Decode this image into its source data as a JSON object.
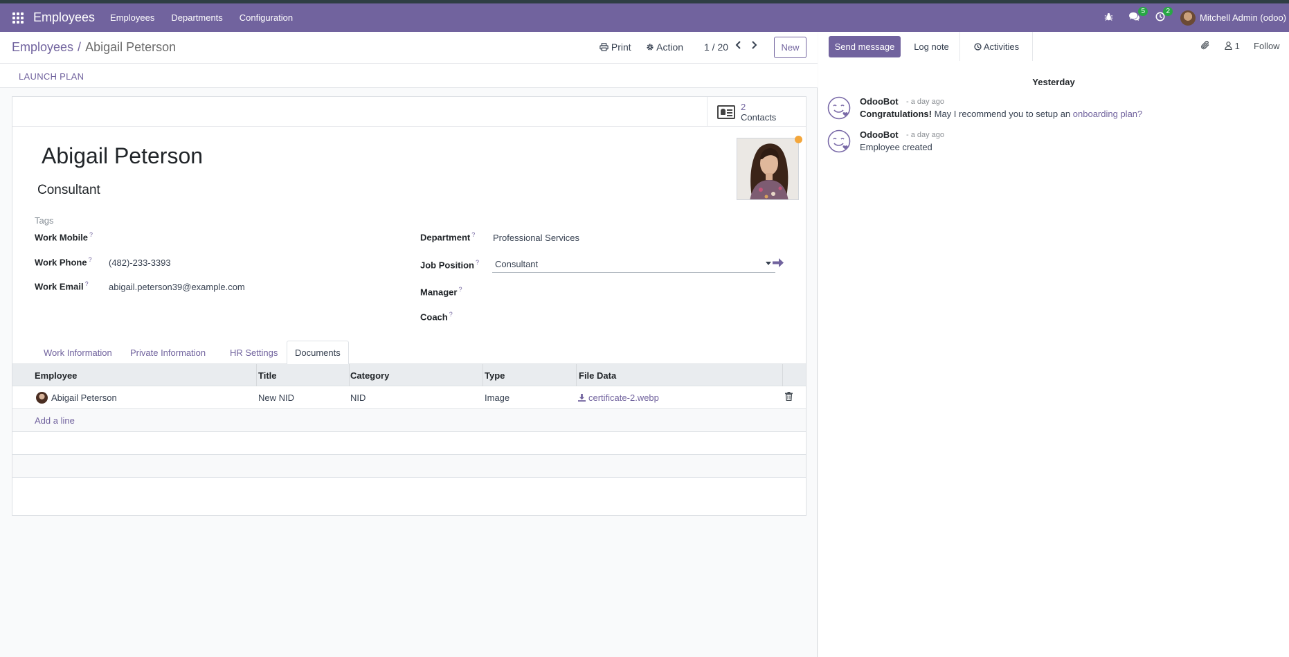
{
  "navbar": {
    "app_name": "Employees",
    "menu": [
      "Employees",
      "Departments",
      "Configuration"
    ],
    "messages_count": "5",
    "activities_count": "2",
    "user_name": "Mitchell Admin (odoo)"
  },
  "control_panel": {
    "breadcrumb_parent": "Employees",
    "breadcrumb_current": "Abigail Peterson",
    "print_label": "Print",
    "action_label": "Action",
    "pager": "1 / 20",
    "new_label": "New"
  },
  "statusbar": {
    "launch_plan": "LAUNCH PLAN"
  },
  "stat_buttons": {
    "contacts_value": "2",
    "contacts_label": "Contacts"
  },
  "employee": {
    "name": "Abigail Peterson",
    "job_title": "Consultant",
    "tags_placeholder": "Tags",
    "status_color": "#f3a63b"
  },
  "fields": {
    "work_mobile_label": "Work Mobile",
    "work_mobile_value": "",
    "work_phone_label": "Work Phone",
    "work_phone_value": "(482)-233-3393",
    "work_email_label": "Work Email",
    "work_email_value": "abigail.peterson39@example.com",
    "department_label": "Department",
    "department_value": "Professional Services",
    "job_position_label": "Job Position",
    "job_position_value": "Consultant",
    "manager_label": "Manager",
    "manager_value": "",
    "coach_label": "Coach",
    "coach_value": "",
    "help_mark": "?"
  },
  "tabs": [
    "Work Information",
    "Private Information",
    "HR Settings",
    "Documents"
  ],
  "active_tab": "Documents",
  "documents": {
    "columns": [
      "Employee",
      "Title",
      "Category",
      "Type",
      "File Data"
    ],
    "rows": [
      {
        "employee": "Abigail Peterson",
        "title": "New NID",
        "category": "NID",
        "type": "Image",
        "file": "certificate-2.webp"
      }
    ],
    "add_line": "Add a line"
  },
  "chatter": {
    "send_message": "Send message",
    "log_note": "Log note",
    "activities": "Activities",
    "followers_count": "1",
    "follow": "Follow",
    "day_separator": "Yesterday",
    "messages": [
      {
        "author": "OdooBot",
        "date": "- a day ago",
        "strong": "Congratulations!",
        "text": " May I recommend you to setup an ",
        "link": "onboarding plan?"
      },
      {
        "author": "OdooBot",
        "date": "- a day ago",
        "strong": "",
        "text": "Employee created",
        "link": ""
      }
    ]
  },
  "colors": {
    "brand": "#71639e",
    "badge": "#28a745"
  }
}
